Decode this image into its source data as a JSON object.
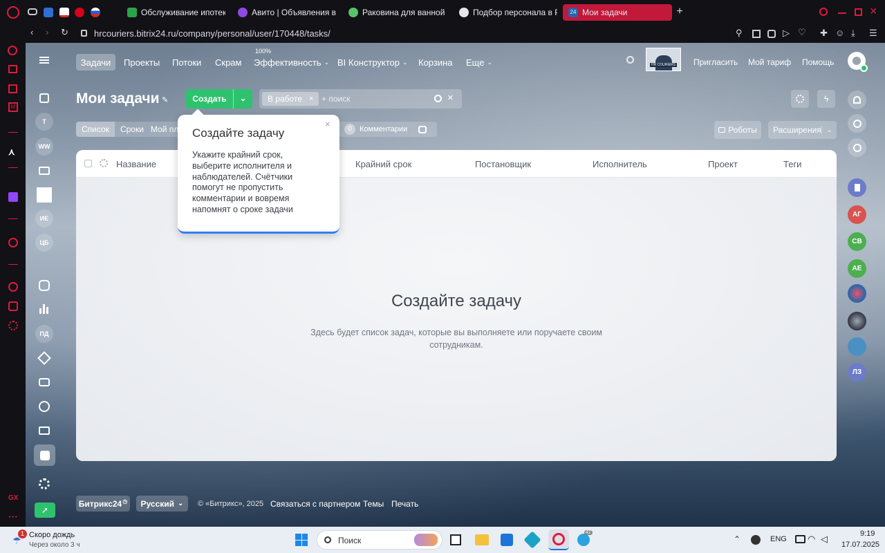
{
  "browser": {
    "tabs": [
      {
        "label": "Обслуживание ипотеки",
        "color": "#2aa54a"
      },
      {
        "label": "Авито | Объявления в Пе",
        "color": "#8f4ae3"
      },
      {
        "label": "Раковина для ванной с п",
        "color": "#5ac26b"
      },
      {
        "label": "Подбор персонала в Рос",
        "color": "#e6e6e6"
      },
      {
        "label": "Мои задачи",
        "color": "#2066b0"
      }
    ],
    "pinned": [
      "vk",
      "gmail",
      "hh",
      "rus"
    ],
    "address": "hrcouriers.bitrix24.ru/company/personal/user/170448/tasks/",
    "accent": "#e01a3e"
  },
  "nav": {
    "items": [
      "Задачи",
      "Проекты",
      "Потоки",
      "Скрам",
      "Эффективность",
      "BI Конструктор",
      "Корзина",
      "Еще"
    ],
    "efficiency_badge": "100%",
    "invite": "Пригласить",
    "tariff": "Мой тариф",
    "help": "Помощь",
    "logo_text": "HR COURIERS"
  },
  "toolbar": {
    "title": "Мои задачи",
    "create": "Создать",
    "filter_tag": "В работе",
    "search_placeholder": "+ поиск",
    "robots": "Роботы",
    "extensions": "Расширения"
  },
  "views": [
    "Список",
    "Сроки",
    "Мой пла"
  ],
  "counter": {
    "value": "0",
    "label": "Комментарии"
  },
  "table": {
    "columns": [
      "Название",
      "Крайний срок",
      "Постановщик",
      "Исполнитель",
      "Проект",
      "Теги"
    ],
    "empty_title": "Создайте задачу",
    "empty_text": "Здесь будет список задач, которые вы выполняете или поручаете своим сотрудникам."
  },
  "popup": {
    "title": "Создайте задачу",
    "text": "Укажите крайний срок, выберите исполнителя и наблюдателей. Счётчики помогут не пропустить комментарии и вовремя напомнят о сроке задачи"
  },
  "left_sidebar": {
    "avatars": [
      "Т",
      "WW",
      "ИЕ",
      "ЦБ",
      "ПД"
    ]
  },
  "right_sidebar": {
    "avatars": [
      "АГ",
      "СВ",
      "АЕ",
      "ЛЗ"
    ],
    "colors": [
      "#d9534f",
      "#4caf50",
      "#4caf50",
      "#6d7cc9"
    ]
  },
  "footer": {
    "brand": "Битрикс24",
    "lang": "Русский",
    "copyright": "© «Битрикс», 2025",
    "links": [
      "Связаться с партнером",
      "Темы",
      "Печать"
    ]
  },
  "taskbar": {
    "weather_title": "Скоро дождь",
    "weather_sub": "Через около 3 ч",
    "weather_badge": "1",
    "search": "Поиск",
    "lang": "ENG",
    "time": "9:19",
    "date": "17.07.2025",
    "telegram_badge": "42"
  }
}
